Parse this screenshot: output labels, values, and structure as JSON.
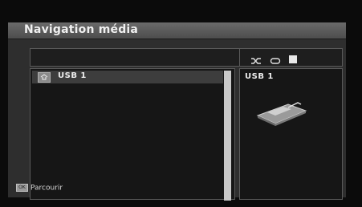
{
  "header": {
    "title": "Navigation média"
  },
  "list": {
    "items": [
      {
        "label": "USB 1",
        "icon": "usb-folder-icon"
      }
    ]
  },
  "controls": {
    "icons": [
      "shuffle-icon",
      "repeat-icon",
      "stop-icon"
    ]
  },
  "info": {
    "label": "USB 1",
    "icon": "usb-device-icon"
  },
  "footer": {
    "hint": "Parcourir",
    "key": "ok-key-icon"
  },
  "colors": {
    "background": "#0b0b0b",
    "panel": "#2e2e2e",
    "title_bar": "#5a5a5a",
    "text": "#e6e6e6"
  }
}
